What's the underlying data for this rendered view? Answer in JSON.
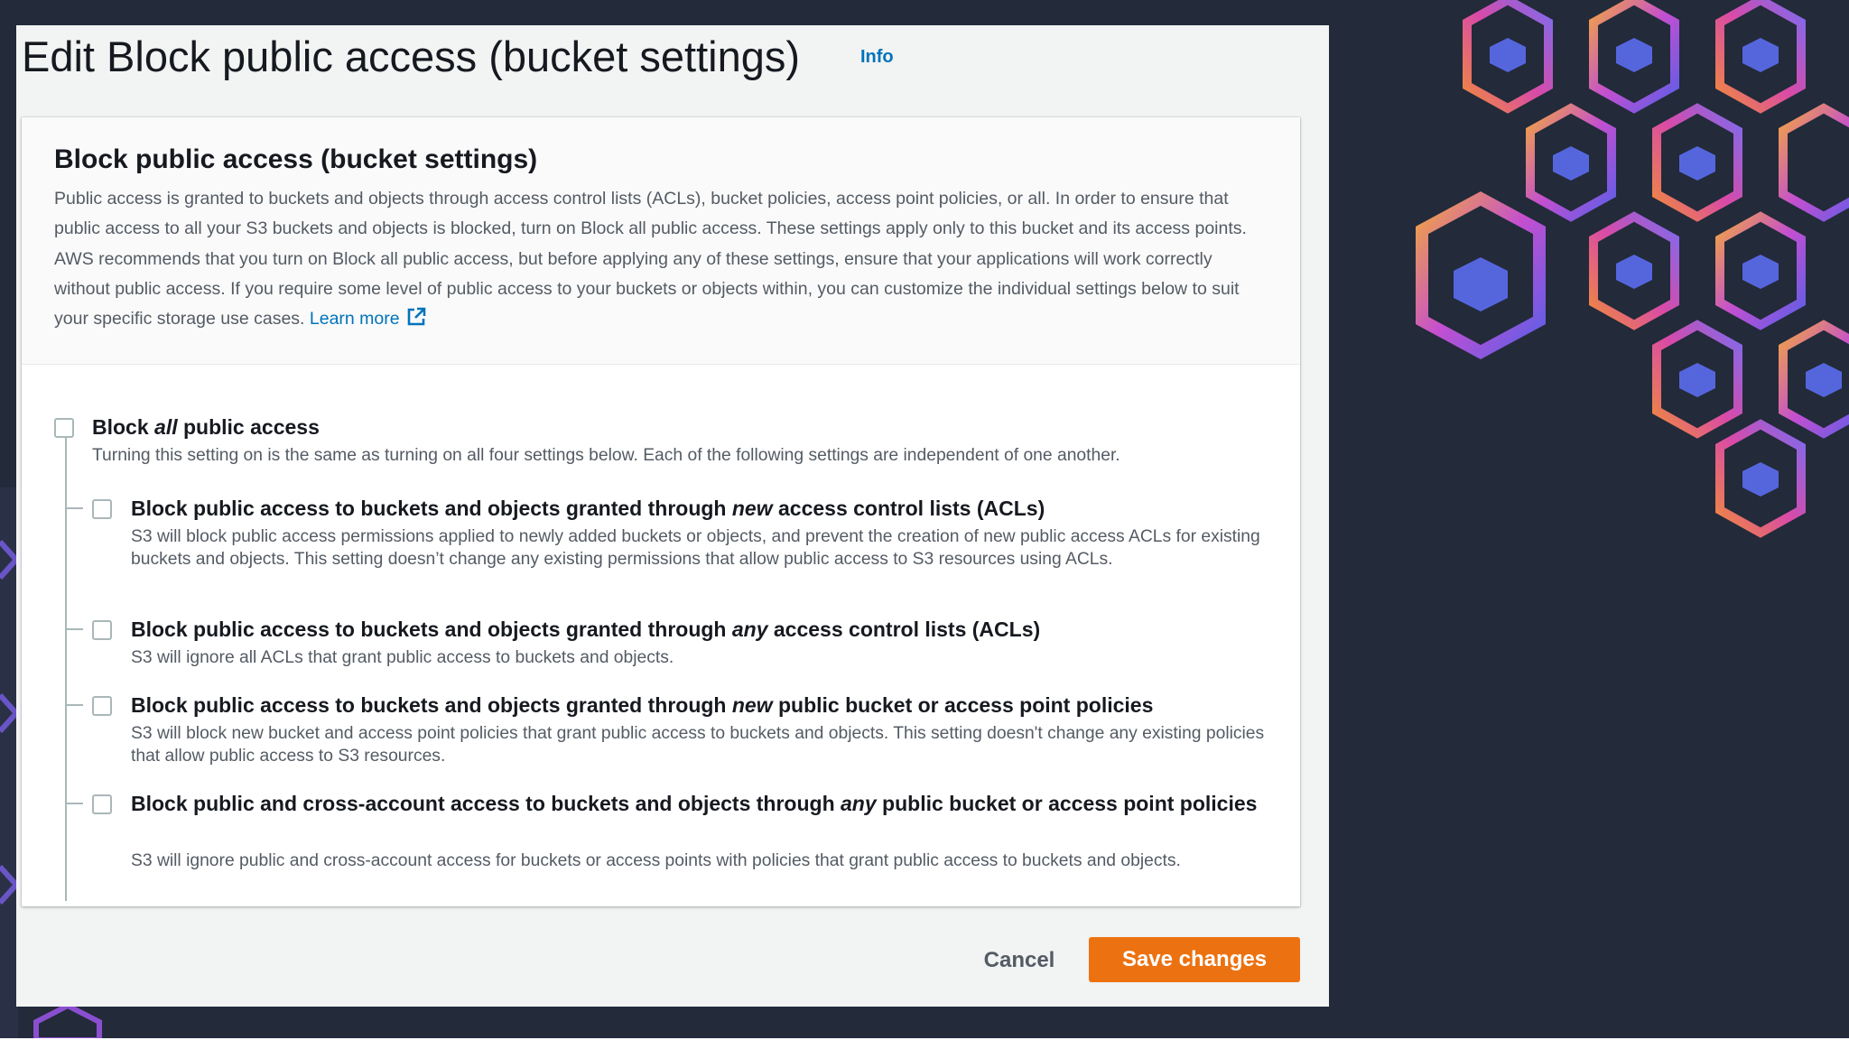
{
  "page": {
    "title": "Edit Block public access (bucket settings)",
    "info_link": "Info"
  },
  "panel": {
    "title": "Block public access (bucket settings)",
    "description": "Public access is granted to buckets and objects through access control lists (ACLs), bucket policies, access point policies, or all. In order to ensure that public access to all your S3 buckets and objects is blocked, turn on Block all public access. These settings apply only to this bucket and its access points. AWS recommends that you turn on Block all public access, but before applying any of these settings, ensure that your applications will work correctly without public access. If you require some level of public access to your buckets or objects within, you can customize the individual settings below to suit your specific storage use cases.",
    "learn_more": "Learn more"
  },
  "block_all": {
    "label_pre": "Block",
    "label_em": "all",
    "label_post": "public access",
    "description": "Turning this setting on is the same as turning on all four settings below. Each of the following settings are independent of one another.",
    "checked": false
  },
  "options": [
    {
      "label_pre": "Block public access to buckets and objects granted through",
      "label_em": "new",
      "label_post": "access control lists (ACLs)",
      "description": "S3 will block public access permissions applied to newly added buckets or objects, and prevent the creation of new public access ACLs for existing buckets and objects. This setting doesn’t change any existing permissions that allow public access to S3 resources using ACLs.",
      "checked": false
    },
    {
      "label_pre": "Block public access to buckets and objects granted through",
      "label_em": "any",
      "label_post": "access control lists (ACLs)",
      "description": "S3 will ignore all ACLs that grant public access to buckets and objects.",
      "checked": false
    },
    {
      "label_pre": "Block public access to buckets and objects granted through",
      "label_em": "new",
      "label_post": "public bucket or access point policies",
      "description": "S3 will block new bucket and access point policies that grant public access to buckets and objects. This setting doesn't change any existing policies that allow public access to S3 resources.",
      "checked": false
    },
    {
      "label_pre": "Block public and cross-account access to buckets and objects through",
      "label_em": "any",
      "label_post": "public bucket or access point policies",
      "description": "S3 will ignore public and cross-account access for buckets or access points with policies that grant public access to buckets and objects.",
      "checked": false
    }
  ],
  "footer": {
    "cancel": "Cancel",
    "save": "Save changes"
  },
  "colors": {
    "primary_button": "#ec7211",
    "link": "#0073bb",
    "background": "#232a3a"
  }
}
